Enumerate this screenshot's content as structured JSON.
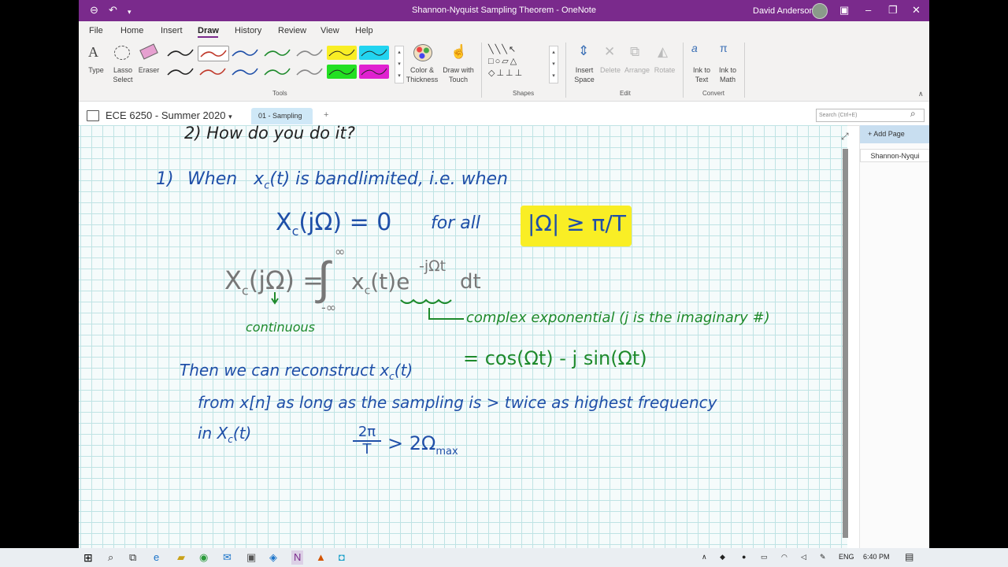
{
  "window": {
    "title": "Shannon-Nyquist Sampling Theorem  -  OneNote",
    "user": "David Anderson"
  },
  "menu": [
    "File",
    "Home",
    "Insert",
    "Draw",
    "History",
    "Review",
    "View",
    "Help"
  ],
  "ribbon": {
    "tools": {
      "type": "Type",
      "lasso": "Lasso Select",
      "eraser": "Eraser",
      "group": "Tools"
    },
    "color_thickness": "Color & Thickness",
    "draw_touch": "Draw with Touch",
    "shapes_group": "Shapes",
    "edit": {
      "insert_space": "Insert Space",
      "delete": "Delete",
      "arrange": "Arrange",
      "rotate": "Rotate",
      "group": "Edit"
    },
    "convert": {
      "ink_text": "Ink to Text",
      "ink_math": "Ink to Math",
      "group": "Convert"
    },
    "pen_colors": [
      "#222222",
      "#c0392b",
      "#1f4fa8",
      "#1e8a2c",
      "#888888",
      "#f9ee25",
      "#22d4f0",
      "#222222",
      "#c0392b",
      "#1f4fa8",
      "#1e8a2c",
      "#888888",
      "#22e022",
      "#e020d0"
    ]
  },
  "notebook": {
    "name": "ECE 6250 - Summer 2020",
    "section": "01 - Sampling",
    "add_section": "+",
    "search_placeholder": "Search (Ctrl+E)"
  },
  "pages_panel": {
    "add_page": "Add Page",
    "page": "Shannon-Nyqui"
  },
  "ink": {
    "question": "2)  How do you do it?",
    "l1_num": "1)",
    "l1_a": "When",
    "l1_b": "x",
    "l1_c": "c",
    "l1_d": "(t)  is  bandlimited,  i.e.  when",
    "l2_a": "X",
    "l2_b": "c",
    "l2_c": "(jΩ) = 0",
    "l2_d": "for  all",
    "l2_e": "|Ω| ≥ π/T",
    "int_lhs": "X",
    "int_sub": "c",
    "int_lhs2": "(jΩ) =",
    "int_sym": "∫",
    "int_up": "∞",
    "int_low": "-∞",
    "int_body": "x",
    "int_body_sub": "c",
    "int_body2": "(t)e",
    "int_exp": "-jΩt",
    "int_dt": "dt",
    "continuous": "continuous",
    "complex_exp": "complex  exponential      (j is the imaginary #)",
    "euler": "= cos(Ωt) - j sin(Ωt)",
    "recon_1": "Then  we  can  reconstruct   x",
    "recon_1_sub": "c",
    "recon_1b": "(t)",
    "recon_2": "from  x[n]   as  long  as   the  sampling  is > twice  as  highest  frequency",
    "recon_3": "in    X",
    "recon_3_sub": "c",
    "recon_3b": "(t)",
    "cond_num": "2π",
    "cond_den": "T",
    "cond_rest": "> 2Ω",
    "cond_sub": "max"
  },
  "taskbar": {
    "lang": "ENG",
    "time": "6:40 PM"
  }
}
